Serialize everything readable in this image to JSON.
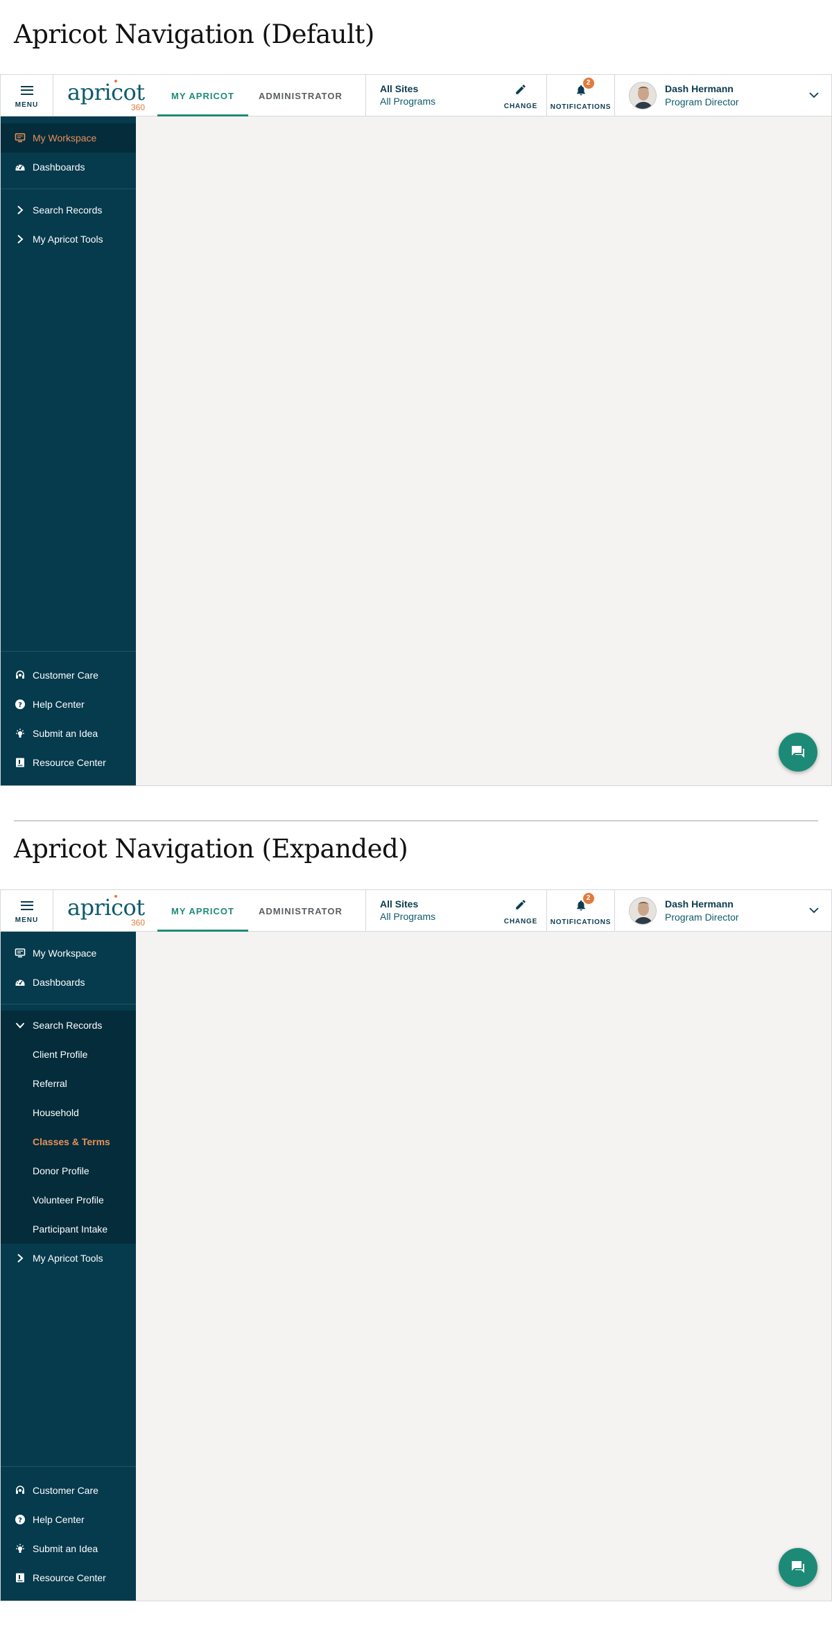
{
  "sections": [
    {
      "title": "Apricot Navigation (Default)",
      "header": {
        "menu_label": "MENU",
        "logo": {
          "word": "apricot",
          "number": "360"
        },
        "tabs": [
          "MY APRICOT",
          "ADMINISTRATOR"
        ],
        "active_tab": "MY APRICOT",
        "sites": "All Sites",
        "programs": "All Programs",
        "change_label": "CHANGE",
        "notifications_label": "NOTIFICATIONS",
        "notification_count": "2",
        "user_name": "Dash Hermann",
        "user_role": "Program Director"
      },
      "sidebar": {
        "top": [
          {
            "label": "My Workspace",
            "icon": "workspace-icon",
            "active": true
          },
          {
            "label": "Dashboards",
            "icon": "dashboard-icon",
            "active": false
          }
        ],
        "groups": [
          {
            "label": "Search Records",
            "icon": "chevron-right-icon",
            "expanded": false
          },
          {
            "label": "My Apricot Tools",
            "icon": "chevron-right-icon",
            "expanded": false
          }
        ],
        "bottom": [
          {
            "label": "Customer Care",
            "icon": "headset-icon"
          },
          {
            "label": "Help Center",
            "icon": "help-icon"
          },
          {
            "label": "Submit an Idea",
            "icon": "lightbulb-icon"
          },
          {
            "label": "Resource Center",
            "icon": "book-icon"
          }
        ]
      }
    },
    {
      "title": "Apricot Navigation (Expanded)",
      "header": {
        "menu_label": "MENU",
        "logo": {
          "word": "apricot",
          "number": "360"
        },
        "tabs": [
          "MY APRICOT",
          "ADMINISTRATOR"
        ],
        "active_tab": "MY APRICOT",
        "sites": "All Sites",
        "programs": "All Programs",
        "change_label": "CHANGE",
        "notifications_label": "NOTIFICATIONS",
        "notification_count": "2",
        "user_name": "Dash Hermann",
        "user_role": "Program Director"
      },
      "sidebar": {
        "top": [
          {
            "label": "My Workspace",
            "icon": "workspace-icon",
            "active": false
          },
          {
            "label": "Dashboards",
            "icon": "dashboard-icon",
            "active": false
          }
        ],
        "groups": [
          {
            "label": "Search Records",
            "icon": "chevron-down-icon",
            "expanded": true,
            "items": [
              "Client Profile",
              "Referral",
              "Household",
              "Classes & Terms",
              "Donor Profile",
              "Volunteer Profile",
              "Participant Intake"
            ],
            "current": "Classes & Terms"
          },
          {
            "label": "My Apricot Tools",
            "icon": "chevron-right-icon",
            "expanded": false
          }
        ],
        "bottom": [
          {
            "label": "Customer Care",
            "icon": "headset-icon"
          },
          {
            "label": "Help Center",
            "icon": "help-icon"
          },
          {
            "label": "Submit an Idea",
            "icon": "lightbulb-icon"
          },
          {
            "label": "Resource Center",
            "icon": "book-icon"
          }
        ]
      }
    }
  ],
  "colors": {
    "sidebar": "#063a4d",
    "sidebar_active": "#042c3b",
    "accent_orange": "#e8905a",
    "accent_teal": "#1d8a78",
    "content_bg": "#f4f3f1"
  }
}
